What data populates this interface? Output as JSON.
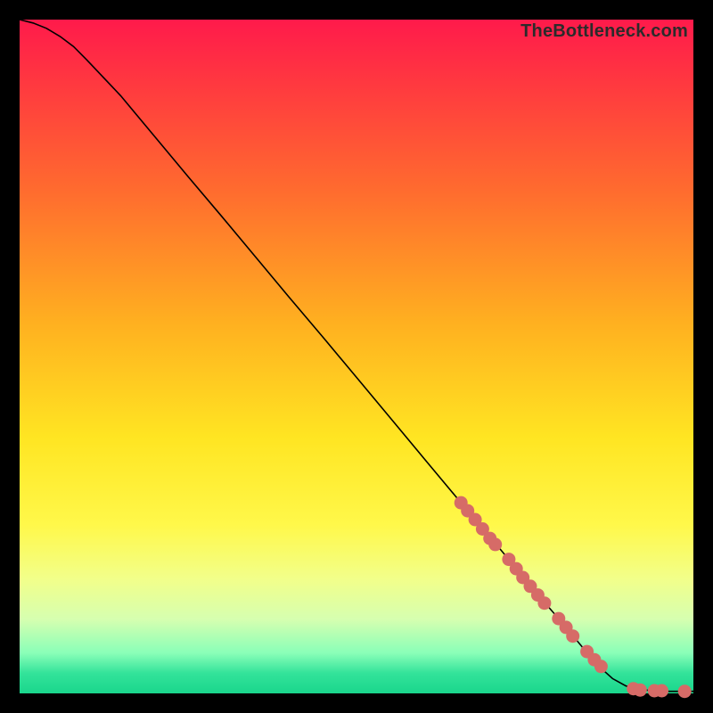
{
  "watermark": "TheBottleneck.com",
  "chart_data": {
    "type": "line",
    "title": "",
    "xlabel": "",
    "ylabel": "",
    "xlim": [
      0,
      100
    ],
    "ylim": [
      0,
      100
    ],
    "grid": false,
    "legend": false,
    "series": [
      {
        "name": "curve",
        "x": [
          0,
          2,
          4,
          6,
          8,
          10,
          15,
          20,
          25,
          30,
          35,
          40,
          45,
          50,
          55,
          60,
          65,
          70,
          72,
          74,
          76,
          78,
          80,
          82,
          84,
          86,
          88,
          90,
          92,
          94,
          96,
          98,
          100
        ],
        "y": [
          100,
          99.5,
          98.7,
          97.5,
          96.0,
          94.0,
          88.7,
          82.7,
          76.7,
          70.8,
          64.8,
          58.8,
          52.9,
          46.9,
          40.9,
          34.9,
          28.9,
          23.0,
          20.6,
          18.2,
          15.8,
          13.4,
          11.1,
          8.7,
          6.3,
          4.0,
          2.2,
          1.1,
          0.6,
          0.4,
          0.3,
          0.3,
          0.3
        ]
      },
      {
        "name": "dots",
        "x": [
          65.5,
          66.5,
          67.6,
          68.7,
          69.8,
          70.6,
          72.6,
          73.7,
          74.7,
          75.8,
          76.9,
          77.9,
          80.0,
          81.1,
          82.1,
          84.2,
          85.3,
          86.3,
          91.1,
          92.1,
          94.2,
          95.3,
          98.7
        ],
        "y": [
          28.3,
          27.1,
          25.8,
          24.4,
          23.0,
          22.1,
          19.9,
          18.5,
          17.2,
          15.9,
          14.6,
          13.4,
          11.1,
          9.8,
          8.5,
          6.2,
          5.0,
          4.0,
          0.7,
          0.5,
          0.4,
          0.4,
          0.3
        ]
      }
    ],
    "dot_color": "#d66b67",
    "line_color": "#000000",
    "background_gradient": [
      "#ff1a4b",
      "#ffe522",
      "#1ad68c"
    ]
  }
}
